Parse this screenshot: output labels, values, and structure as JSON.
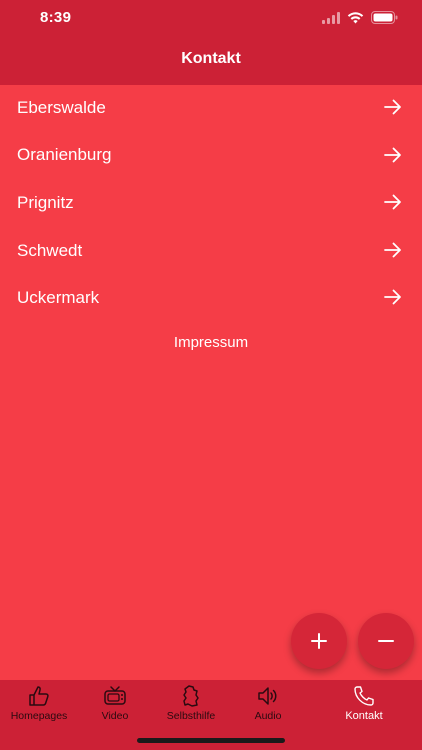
{
  "status_bar": {
    "time": "8:39"
  },
  "nav": {
    "title": "Kontakt"
  },
  "locations": [
    {
      "label": "Eberswalde"
    },
    {
      "label": "Oranienburg"
    },
    {
      "label": "Prignitz"
    },
    {
      "label": "Schwedt"
    },
    {
      "label": "Uckermark"
    }
  ],
  "impressum_label": "Impressum",
  "fab": {
    "increase": "+",
    "decrease": "−"
  },
  "tabbar": {
    "tabs": [
      {
        "label": "Homepages",
        "icon": "thumbs-up-icon"
      },
      {
        "label": "Video",
        "icon": "tv-icon"
      },
      {
        "label": "Selbsthilfe",
        "icon": "map-icon"
      },
      {
        "label": "Audio",
        "icon": "speaker-icon"
      },
      {
        "label": "Kontakt",
        "icon": "phone-icon"
      }
    ],
    "active_index": 4
  },
  "colors": {
    "background": "#f53d47",
    "header": "#cc2136",
    "fab": "#d52638",
    "tab_inactive": "#2a0a10",
    "tab_active": "#ffffff"
  }
}
